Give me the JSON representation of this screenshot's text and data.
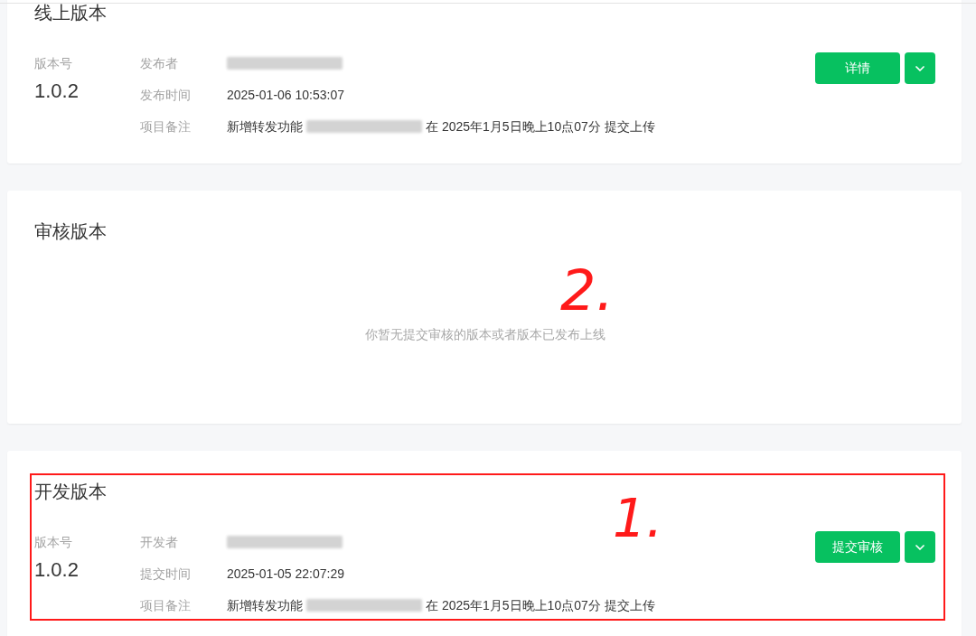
{
  "sections": [
    {
      "kind": "release",
      "title": "线上版本",
      "highlighted": false,
      "version_label": "版本号",
      "version": "1.0.2",
      "fields": [
        {
          "label": "发布者",
          "parts": [
            {
              "kind": "redacted"
            }
          ]
        },
        {
          "label": "发布时间",
          "parts": [
            {
              "kind": "text",
              "text": "2025-01-06 10:53:07"
            }
          ]
        },
        {
          "label": "项目备注",
          "parts": [
            {
              "kind": "text",
              "text": "新增转发功能"
            },
            {
              "kind": "redacted"
            },
            {
              "kind": "text",
              "text": "在 2025年1月5日晚上10点07分 提交上传"
            }
          ]
        }
      ],
      "primary_button": "详情"
    },
    {
      "kind": "empty",
      "title": "审核版本",
      "highlighted": false,
      "message": "你暂无提交审核的版本或者版本已发布上线",
      "annotation": "2."
    },
    {
      "kind": "release",
      "title": "开发版本",
      "highlighted": true,
      "version_label": "版本号",
      "version": "1.0.2",
      "fields": [
        {
          "label": "开发者",
          "parts": [
            {
              "kind": "redacted"
            }
          ]
        },
        {
          "label": "提交时间",
          "parts": [
            {
              "kind": "text",
              "text": "2025-01-05 22:07:29"
            }
          ]
        },
        {
          "label": "项目备注",
          "parts": [
            {
              "kind": "text",
              "text": "新增转发功能"
            },
            {
              "kind": "redacted"
            },
            {
              "kind": "text",
              "text": "在 2025年1月5日晚上10点07分 提交上传"
            }
          ]
        }
      ],
      "primary_button": "提交审核",
      "annotation": "1."
    }
  ]
}
